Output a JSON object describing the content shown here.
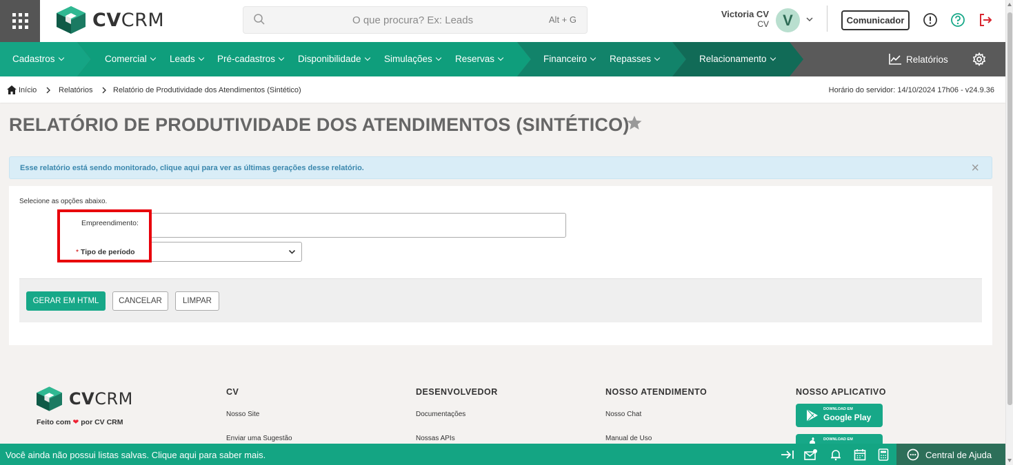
{
  "header": {
    "logo_text_bold": "CV",
    "logo_text_light": "CRM",
    "search": {
      "placeholder": "O que procura? Ex: Leads",
      "shortcut": "Alt + G"
    },
    "user": {
      "name": "Victoria CV",
      "company": "CV",
      "avatar_initial": "V"
    },
    "comunicador_label": "Comunicador"
  },
  "nav": {
    "items": [
      {
        "label": "Cadastros"
      },
      {
        "label": "Comercial"
      },
      {
        "label": "Leads"
      },
      {
        "label": "Pré-cadastros"
      },
      {
        "label": "Disponibilidade"
      },
      {
        "label": "Simulações"
      },
      {
        "label": "Reservas"
      },
      {
        "label": "Financeiro"
      },
      {
        "label": "Repasses"
      },
      {
        "label": "Relacionamento"
      }
    ],
    "reports_label": "Relatórios"
  },
  "breadcrumb": {
    "items": [
      "Início",
      "Relatórios",
      "Relatório de Produtividade dos Atendimentos (Sintético)"
    ],
    "server_time": "Horário do servidor: 14/10/2024 17h06 - v24.9.36"
  },
  "page": {
    "title": "RELATÓRIO DE PRODUTIVIDADE DOS ATENDIMENTOS (SINTÉTICO)",
    "alert": "Esse relatório está sendo monitorado, clique aqui para ver as últimas gerações desse relatório.",
    "alert_close": "×"
  },
  "form": {
    "intro": "Selecione as opções abaixo.",
    "empreendimento_label": "Empreendimento:",
    "empreendimento_value": "",
    "tipo_required_mark": "*",
    "tipo_label": "Tipo de período",
    "tipo_value": "",
    "buttons": {
      "generate": "GERAR EM HTML",
      "cancel": "CANCELAR",
      "clear": "LIMPAR"
    }
  },
  "footer": {
    "made_prefix": "Feito com",
    "made_suffix": "por CV CRM",
    "columns": [
      {
        "title": "CV",
        "links": [
          "Nosso Site",
          "Enviar uma Sugestão"
        ]
      },
      {
        "title": "DESENVOLVEDOR",
        "links": [
          "Documentações",
          "Nossas APIs"
        ]
      },
      {
        "title": "NOSSO ATENDIMENTO",
        "links": [
          "Nosso Chat",
          "Manual de Uso"
        ]
      },
      {
        "title": "NOSSO APLICATIVO",
        "links": []
      }
    ],
    "store": {
      "google_small": "DOWNLOAD EM",
      "google_big": "Google Play",
      "apple_small": "DOWNLOAD EM"
    }
  },
  "bottombar": {
    "message": "Você ainda não possui listas salvas. Clique aqui para saber mais.",
    "help_label": "Central de Ajuda"
  },
  "colors": {
    "brand_green": "#17a888",
    "nav_green": "#0f9e7c",
    "nav_dark_green": "#116b57",
    "nav_gray": "#5a5a5a",
    "alert_text": "#3a87ad",
    "highlight_red": "#e8000b",
    "logout_red": "#d9252f"
  }
}
